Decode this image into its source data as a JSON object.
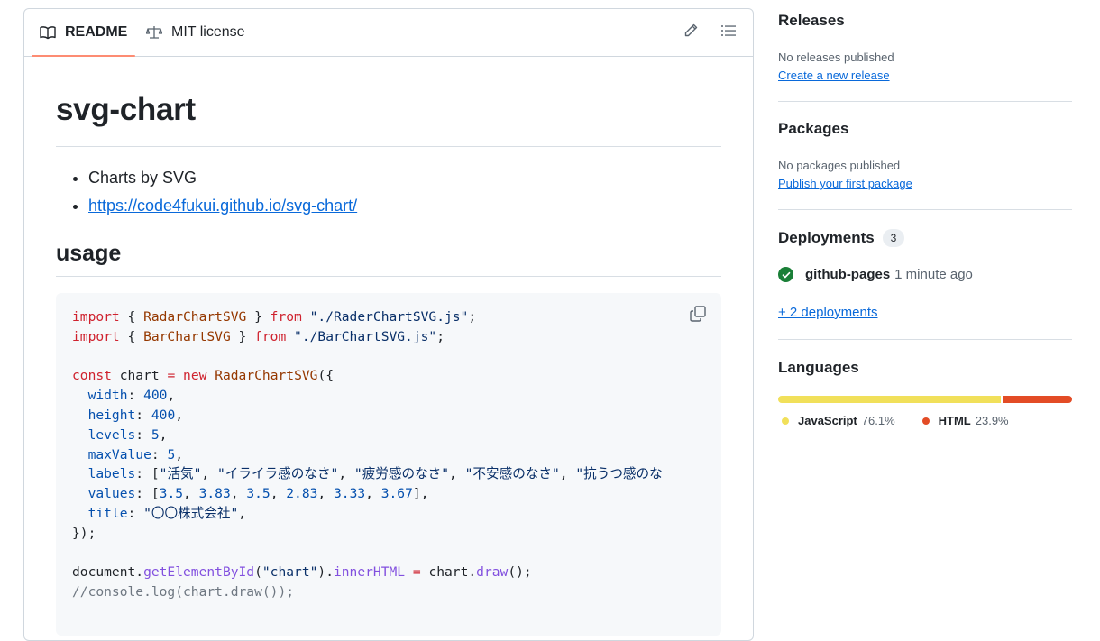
{
  "readme": {
    "tabs": [
      {
        "label": "README",
        "icon": "book-icon",
        "active": true
      },
      {
        "label": "MIT license",
        "icon": "scale-icon",
        "active": false
      }
    ],
    "title": "svg-chart",
    "bullets": [
      "Charts by SVG",
      "https://code4fukui.github.io/svg-chart/"
    ],
    "usage_heading": "usage",
    "code_lines": [
      "import { RadarChartSVG } from \"./RaderChartSVG.js\";",
      "import { BarChartSVG } from \"./BarChartSVG.js\";",
      "",
      "const chart = new RadarChartSVG({",
      "  width: 400,",
      "  height: 400,",
      "  levels: 5,",
      "  maxValue: 5,",
      "  labels: [\"活気\", \"イライラ感のなさ\", \"疲労感のなさ\", \"不安感のなさ\", \"抗うつ感のな",
      "  values: [3.5, 3.83, 3.5, 2.83, 3.33, 3.67],",
      "  title: \"〇〇株式会社\",",
      "});",
      "",
      "document.getElementById(\"chart\").innerHTML = chart.draw();",
      "//console.log(chart.draw());"
    ]
  },
  "sidebar": {
    "releases": {
      "title": "Releases",
      "status": "No releases published",
      "link": "Create a new release"
    },
    "packages": {
      "title": "Packages",
      "status": "No packages published",
      "link": "Publish your first package"
    },
    "deployments": {
      "title": "Deployments",
      "count": "3",
      "name": "github-pages",
      "time": "1 minute ago",
      "more_link": "+ 2 deployments"
    },
    "languages": {
      "title": "Languages",
      "items": [
        {
          "name": "JavaScript",
          "percent": "76.1%",
          "value": 76.1,
          "color": "#f1e05a"
        },
        {
          "name": "HTML",
          "percent": "23.9%",
          "value": 23.9,
          "color": "#e34c26"
        }
      ]
    }
  }
}
